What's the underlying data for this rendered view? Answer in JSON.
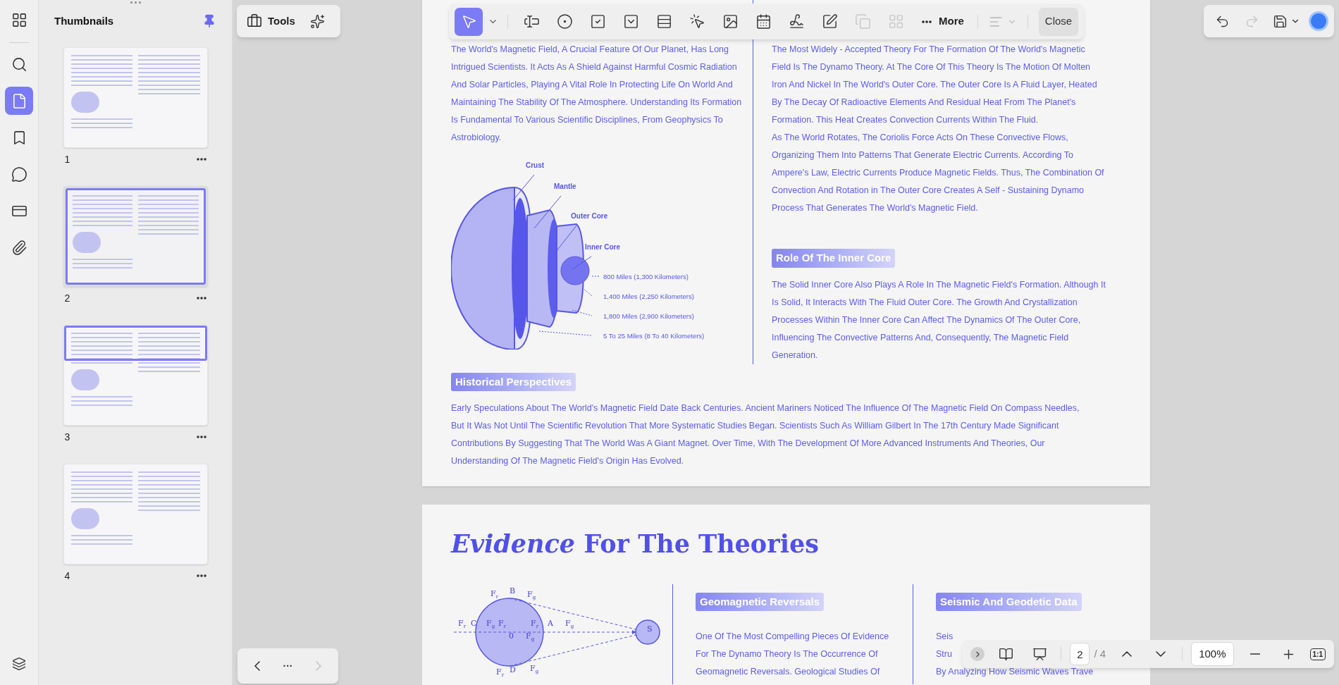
{
  "rail": {
    "items": [
      {
        "kind": "apps",
        "selected": false
      },
      {
        "kind": "search",
        "selected": false
      },
      {
        "kind": "pages",
        "selected": true
      },
      {
        "kind": "bookmarks",
        "selected": false
      },
      {
        "kind": "comments",
        "selected": false
      },
      {
        "kind": "forms",
        "selected": false
      },
      {
        "kind": "attachments",
        "selected": false
      }
    ]
  },
  "thumbnails": {
    "title": "Thumbnails",
    "pinned": true,
    "pages": [
      {
        "number": "1",
        "selected": false,
        "in_view": false
      },
      {
        "number": "2",
        "selected": true,
        "in_view": true
      },
      {
        "number": "3",
        "selected": false,
        "in_view": true
      },
      {
        "number": "4",
        "selected": false,
        "in_view": false
      }
    ]
  },
  "tools_panel": {
    "label": "Tools"
  },
  "form_toolbar": {
    "tools": [
      {
        "kind": "select",
        "selected": true,
        "disabled": false
      },
      {
        "kind": "text-field",
        "selected": false,
        "disabled": false
      },
      {
        "kind": "radio",
        "selected": false,
        "disabled": false
      },
      {
        "kind": "checkbox",
        "selected": false,
        "disabled": false
      },
      {
        "kind": "dropdown",
        "selected": false,
        "disabled": false
      },
      {
        "kind": "list-box",
        "selected": false,
        "disabled": false
      },
      {
        "kind": "button",
        "selected": false,
        "disabled": false
      },
      {
        "kind": "image",
        "selected": false,
        "disabled": false
      },
      {
        "kind": "date",
        "selected": false,
        "disabled": false
      },
      {
        "kind": "signature",
        "selected": false,
        "disabled": false
      },
      {
        "kind": "digital-signature",
        "selected": false,
        "disabled": false
      },
      {
        "kind": "duplicate",
        "selected": false,
        "disabled": true
      },
      {
        "kind": "grid",
        "selected": false,
        "disabled": true
      }
    ],
    "more_label": "More",
    "align_disabled": true,
    "close_label": "Close"
  },
  "page1": {
    "left_paragraph": "The World's Magnetic Field, A Crucial Feature Of Our Planet, Has Long Intrigued Scientists. It Acts As A Shield Against Harmful Cosmic Radiation And Solar Particles, Playing A Vital Role In Protecting Life On World And Maintaining The Stability Of The Atmosphere. Understanding Its Formation Is Fundamental To Various Scientific Disciplines, From Geophysics To Astrobiology.",
    "layer_labels": [
      "Crust",
      "Mantle",
      "Outer Core",
      "Inner Core"
    ],
    "distance_labels": [
      "800 Miles (1,300 Kilometers)",
      "1,400 Miles (2,250 Kilometers)",
      "1,800 Miles (2,900 Kilometers)",
      "5 To 25 Miles (8 To 40 Kilometers)"
    ],
    "right_paragraphs": [
      "The Most Widely - Accepted Theory For The Formation Of The World's Magnetic Field Is The Dynamo Theory. At The Core Of This Theory Is The Motion Of Molten Iron And Nickel In The World's Outer Core. The Outer Core Is A Fluid Layer, Heated By The Decay Of Radioactive Elements And Residual Heat From The Planet's Formation. This Heat Creates Convection Currents Within The Fluid.",
      "As The World Rotates, The Coriolis Force Acts On These Convective Flows, Organizing Them Into Patterns That Generate Electric Currents. According To Ampere's Law, Electric Currents Produce Magnetic Fields. Thus, The Combination Of Convection And Rotation in The Outer Core Creates A Self - Sustaining Dynamo Process That Generates The World's Magnetic Field."
    ],
    "inner_core_heading": "Role Of The Inner Core",
    "inner_core_paragraph": "The Solid Inner Core Also Plays A Role In The Magnetic Field's Formation. Although It Is Solid, It Interacts With The Fluid Outer Core. The Growth And Crystallization Processes Within The Inner Core Can Affect The Dynamics Of The Outer Core, Influencing The Convective Patterns And, Consequently, The Magnetic Field Generation.",
    "history_heading": "Historical Perspectives",
    "history_paragraph": "Early Speculations About The World's Magnetic Field Date Back Centuries. Ancient Mariners Noticed The Influence Of The Magnetic Field On Compass Needles, But It Was Not Until The Scientific Revolution That More Systematic Studies Began. Scientists Such As William Gilbert In The 17th Century Made Significant Contributions By Suggesting That The World Was A Giant Magnet. Over Time, With The Development Of More Advanced Instruments And Theories, Our Understanding Of The Magnetic Field's Origin Has Evolved."
  },
  "page2": {
    "title": "*Evidence* For The Theories",
    "force_labels": [
      "F$_{r}$",
      "B",
      "F$_{g}$",
      "F$_{r}$",
      "C",
      "F$_{g}$",
      "F$_{r}$",
      "F$_{r}$",
      "A",
      "F$_{g}$",
      "0",
      "F$_{g}$",
      "F$_{r}$",
      "D",
      "F$_{g}$",
      "S"
    ],
    "reversals_heading": "Geomagnetic Reversals",
    "reversals_lines": [
      "One Of The Most Compelling Pieces Of Evidence",
      "For The Dynamo Theory Is The Occurrence Of",
      "Geomagnetic Reversals. Geological Studies Of"
    ],
    "seismic_heading": "Seismic And Geodetic Data",
    "seismic_lines": [
      "Seis",
      "Stru",
      "By Analyzing How Seismic Waves Trave"
    ]
  },
  "page_nav": {
    "more": "···",
    "next_disabled": true
  },
  "view_bar": {
    "page": "2",
    "total": "/ 4",
    "zoom": "100%",
    "actual_size": "1:1"
  }
}
